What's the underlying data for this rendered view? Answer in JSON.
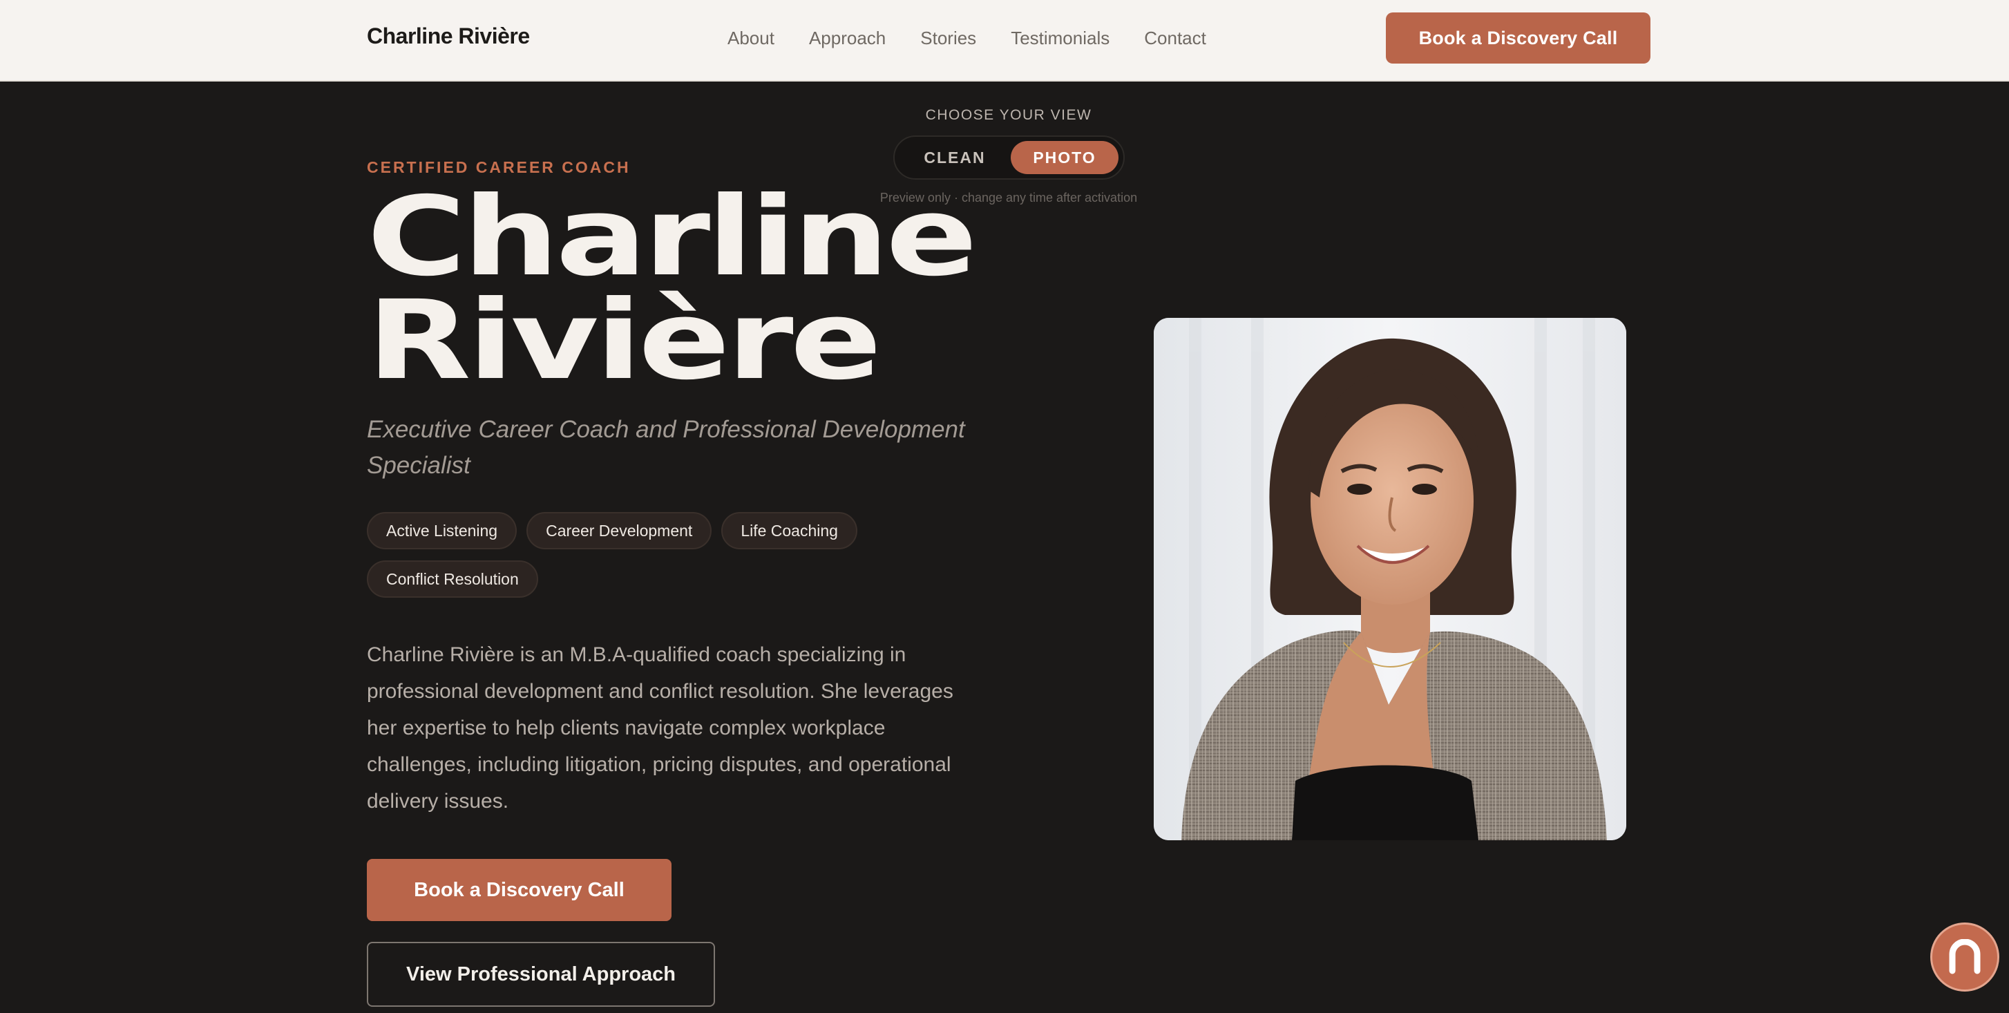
{
  "nav": {
    "brand": "Charline Rivière",
    "links": [
      "About",
      "Approach",
      "Stories",
      "Testimonials",
      "Contact"
    ],
    "cta_label": "Book a Discovery Call"
  },
  "view_toggle": {
    "label": "CHOOSE YOUR VIEW",
    "options": [
      "CLEAN",
      "PHOTO"
    ],
    "selected": "PHOTO",
    "note": "Preview only · change any time after activation"
  },
  "hero": {
    "eyebrow": "CERTIFIED CAREER COACH",
    "name_line1": "Charline",
    "name_line2": "Rivière",
    "subtitle": "Executive Career Coach and Professional Development Specialist",
    "tags": [
      "Active Listening",
      "Career Development",
      "Life Coaching",
      "Conflict Resolution"
    ],
    "bio": "Charline Rivière is an M.B.A-qualified coach specializing in professional development and conflict resolution. She leverages her expertise to help clients navigate complex workplace challenges, including litigation, pricing disputes, and operational delivery issues.",
    "cta_primary": "Book a Discovery Call",
    "cta_secondary": "View Professional Approach"
  },
  "icons": {
    "portrait": "portrait-photo",
    "fab": "chat-widget-icon"
  },
  "colors": {
    "accent": "#b9654a",
    "background": "#1b1918",
    "nav_background": "#f6f3f0"
  }
}
